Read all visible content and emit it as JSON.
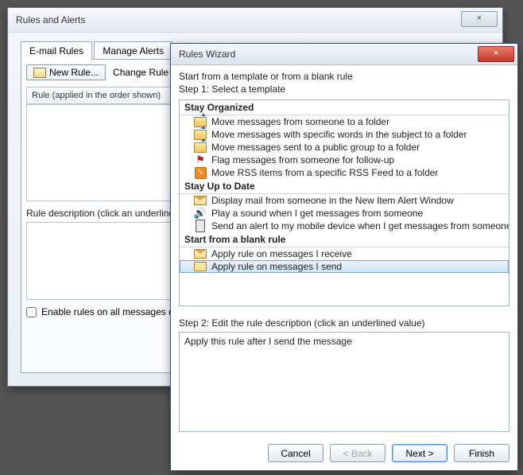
{
  "rules_alerts": {
    "title": "Rules and Alerts",
    "close_glyph": "×",
    "tabs": {
      "email": "E-mail Rules",
      "manage": "Manage Alerts"
    },
    "toolbar": {
      "new_rule": "New Rule...",
      "change_rule": "Change Rule"
    },
    "list_header": "Rule (applied in the order shown)",
    "desc_label": "Rule description (click an underline",
    "checkbox_label": "Enable rules on all messages dow"
  },
  "wizard": {
    "title": "Rules Wizard",
    "close_glyph": "×",
    "intro": "Start from a template or from a blank rule",
    "step1_label": "Step 1: Select a template",
    "groups": {
      "organized": {
        "header": "Stay Organized",
        "items": [
          "Move messages from someone to a folder",
          "Move messages with specific words in the subject to a folder",
          "Move messages sent to a public group to a folder",
          "Flag messages from someone for follow-up",
          "Move RSS items from a specific RSS Feed to a folder"
        ]
      },
      "uptodate": {
        "header": "Stay Up to Date",
        "items": [
          "Display mail from someone in the New Item Alert Window",
          "Play a sound when I get messages from someone",
          "Send an alert to my mobile device when I get messages from someone"
        ]
      },
      "blank": {
        "header": "Start from a blank rule",
        "items": [
          "Apply rule on messages I receive",
          "Apply rule on messages I send"
        ]
      }
    },
    "step2_label": "Step 2: Edit the rule description (click an underlined value)",
    "description_text": "Apply this rule after I send the message",
    "buttons": {
      "cancel": "Cancel",
      "back": "< Back",
      "next": "Next >",
      "finish": "Finish"
    }
  }
}
